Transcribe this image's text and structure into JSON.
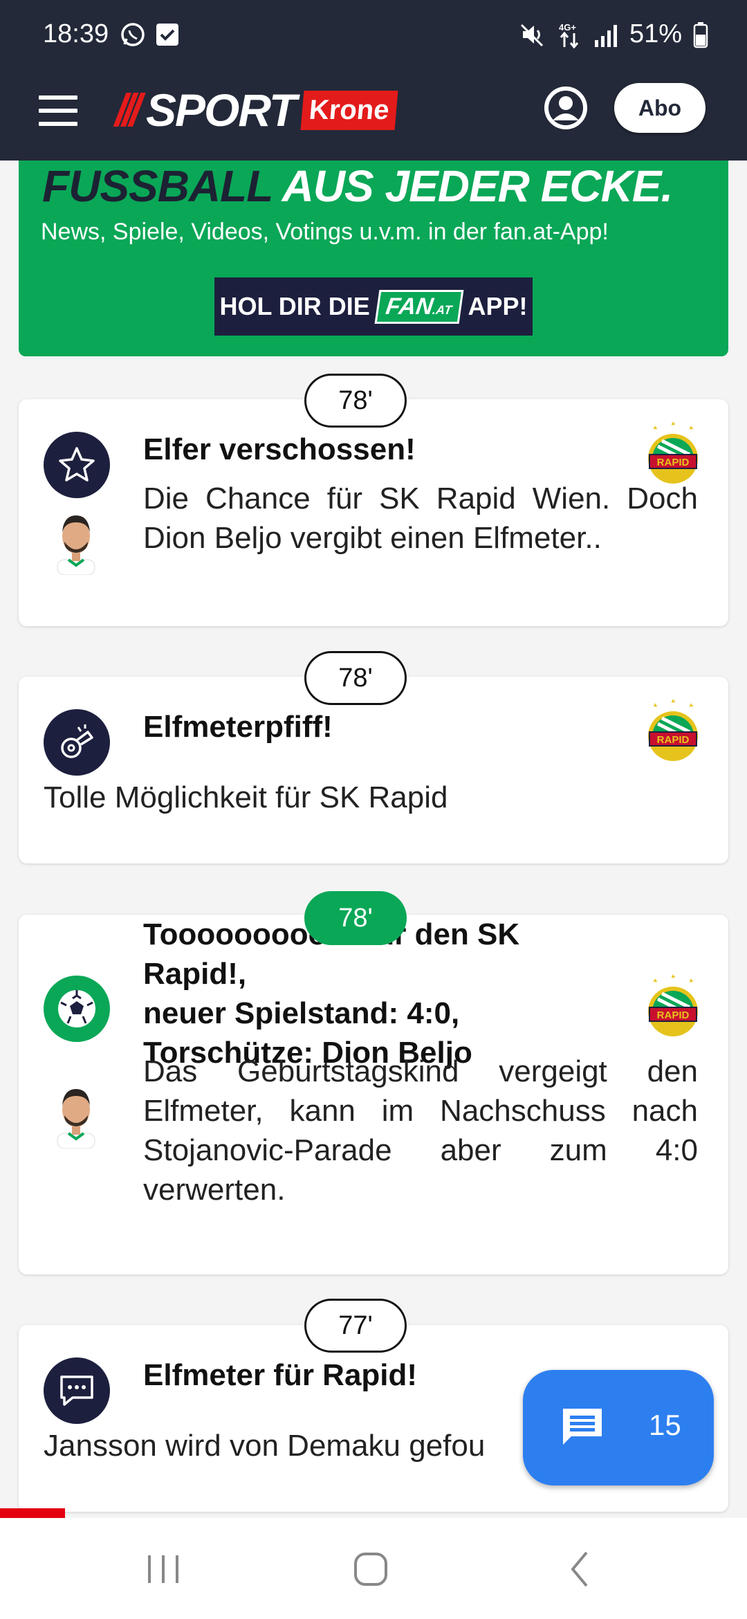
{
  "status_bar": {
    "time": "18:39",
    "battery": "51%"
  },
  "header": {
    "abo_label": "Abo"
  },
  "banner": {
    "headline_dark": "FUSSBALL",
    "headline_light": "AUS JEDER ECKE.",
    "subline": "News, Spiele, Videos, Votings u.v.m. in der fan.at-App!",
    "cta_prefix": "HOL DIR DIE",
    "cta_brand": "FAN",
    "cta_brand_suffix": ".AT",
    "cta_suffix": "APP!"
  },
  "events": [
    {
      "minute": "78'",
      "title": "Elfer verschossen!",
      "text": "Die Chance für SK Rapid Wien. Doch Dion Beljo vergibt einen Elfmeter..",
      "icon": "star-icon",
      "team": "RAPID"
    },
    {
      "minute": "78'",
      "title": "Elfmeterpfiff!",
      "text": "Tolle Möglichkeit für SK Rapid",
      "icon": "whistle-icon",
      "team": "RAPID"
    },
    {
      "minute": "78'",
      "title_lines": [
        "Toooooooooor für den SK Rapid!,",
        "neuer Spielstand: 4:0,",
        "Torschütze: Dion Beljo"
      ],
      "text": "Das Geburtstagskind vergeigt den Elfmeter, kann im Nachschuss nach Stojanovic-Parade aber zum 4:0 verwerten.",
      "icon": "soccer-ball-icon",
      "team": "RAPID"
    },
    {
      "minute": "77'",
      "title": "Elfmeter für Rapid!",
      "text": "Jansson wird von Demaku gefou",
      "icon": "chat-bubble-icon"
    }
  ],
  "comments_fab": {
    "count": "15"
  },
  "colors": {
    "header_bg": "#232939",
    "accent_green": "#0aa757",
    "brand_red": "#e41b1b",
    "fab_blue": "#2d7ff0"
  }
}
